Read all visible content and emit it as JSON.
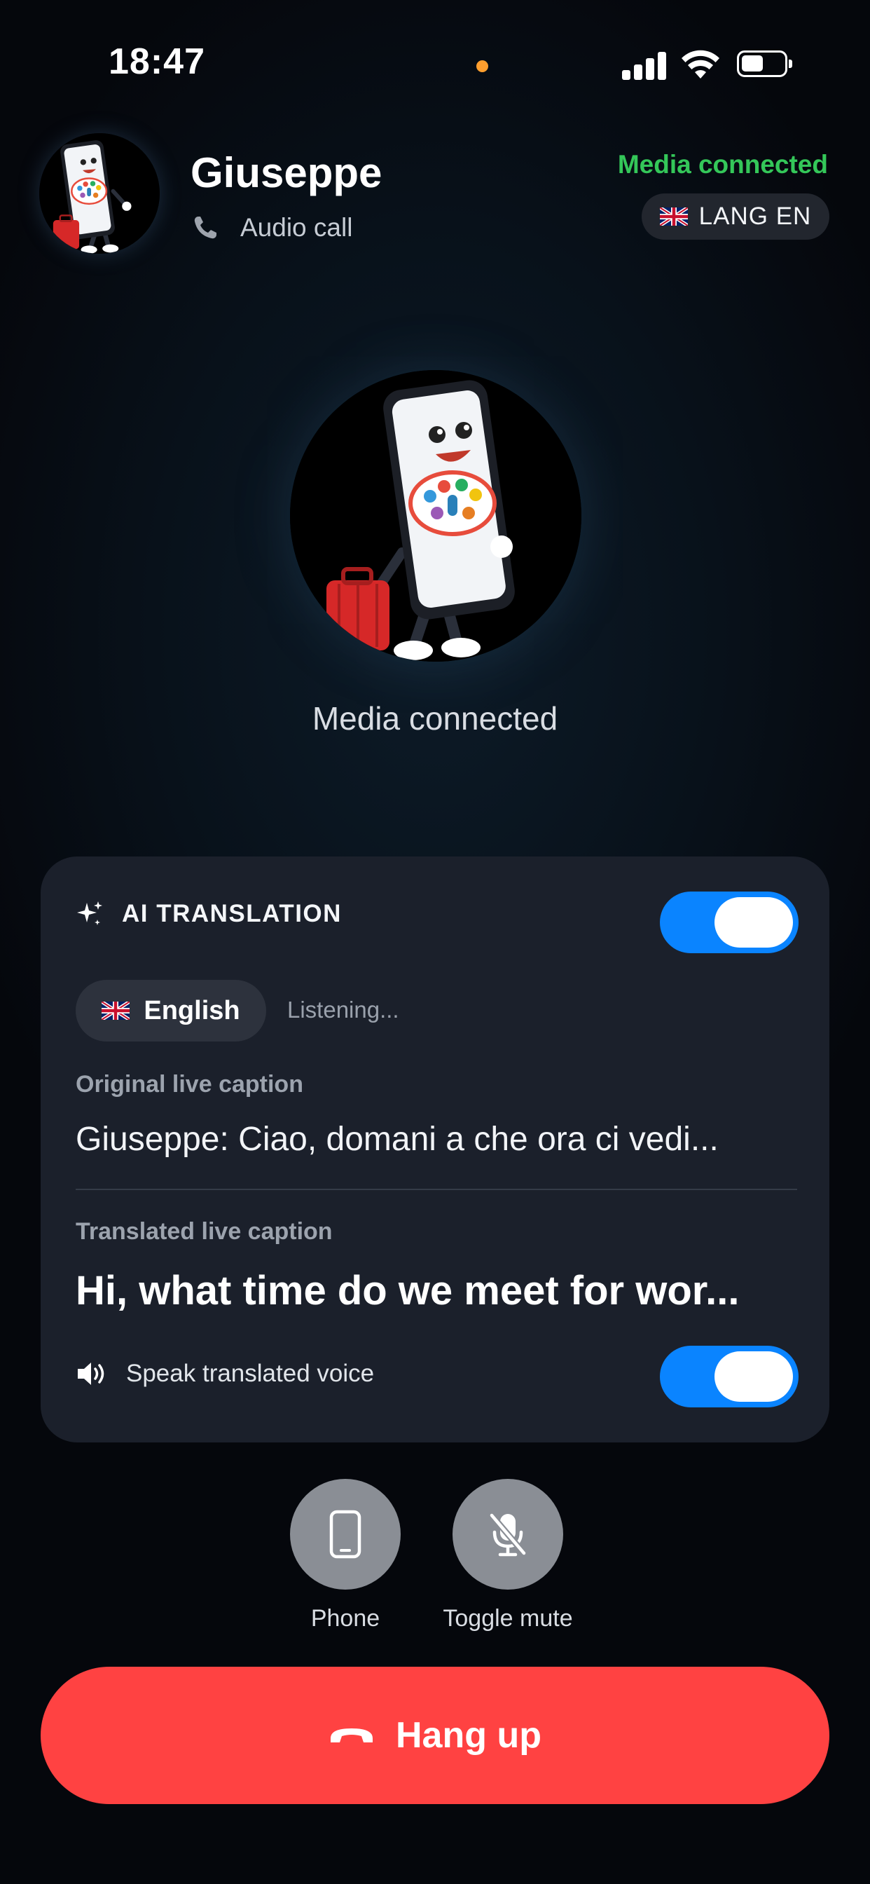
{
  "status_bar": {
    "time": "18:47",
    "indicator_color": "#ff9f2e",
    "icons": [
      "cellular-signal-icon",
      "wifi-icon",
      "battery-icon"
    ]
  },
  "caller": {
    "name": "Giuseppe",
    "call_type": "Audio call",
    "media_status": "Media connected",
    "lang_badge": "LANG EN",
    "lang_flag": "uk-flag-icon"
  },
  "center": {
    "status": "Media connected"
  },
  "translation": {
    "title": "AI TRANSLATION",
    "enabled": true,
    "language": "English",
    "listening": "Listening...",
    "original_label": "Original live caption",
    "original_text": "Giuseppe: Ciao, domani a che ora ci vedi...",
    "translated_label": "Translated live caption",
    "translated_text": "Hi, what time do we meet for wor...",
    "speak_label": "Speak translated voice",
    "speak_enabled": true
  },
  "controls": {
    "phone_label": "Phone",
    "mute_label": "Toggle mute",
    "hangup_label": "Hang up"
  },
  "colors": {
    "accent_green": "#34c759",
    "toggle_blue": "#0a84ff",
    "hangup_red": "#ff4242",
    "card_bg": "#1b202b"
  }
}
